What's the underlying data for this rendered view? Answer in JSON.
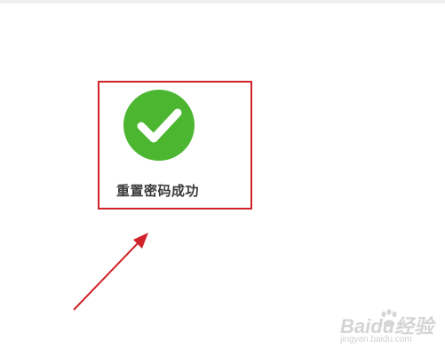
{
  "message": {
    "success_text": "重置密码成功",
    "icon": "check-circle-icon",
    "icon_color": "#4cb630"
  },
  "annotation": {
    "box_color": "#d0232a",
    "arrow_color": "#d0232a"
  },
  "watermark": {
    "brand": "Baidu经验",
    "url": "jingyan.baidu.com"
  }
}
